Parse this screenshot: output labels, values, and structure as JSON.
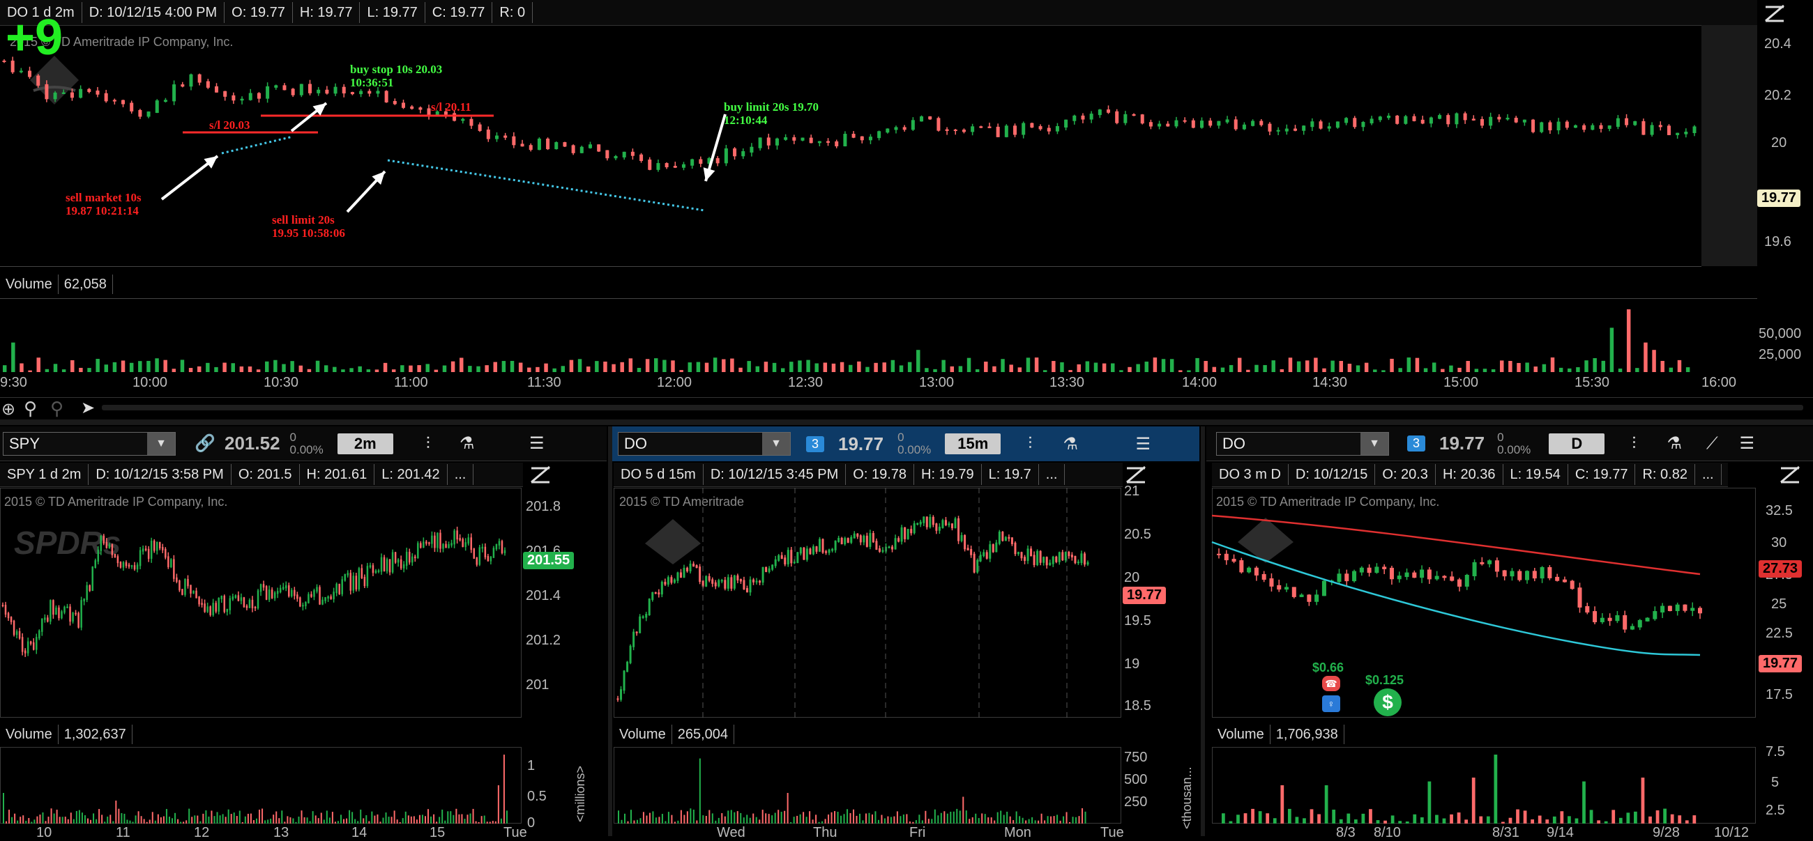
{
  "main": {
    "header": {
      "symbol_period": "DO 1 d 2m",
      "date": "D: 10/12/15 4:00 PM",
      "open": "O: 19.77",
      "high": "H: 19.77",
      "low": "L: 19.77",
      "close": "C: 19.77",
      "range": "R: 0"
    },
    "big_score": "+9",
    "copyright": "2015 © TD Ameritrade IP Company, Inc.",
    "logo_text": "DIAMOND",
    "price_axis": [
      "20.4",
      "20.2",
      "20",
      "19.6"
    ],
    "last_price_tag": "19.77",
    "annotations": {
      "sell_market": "sell market 10s",
      "sell_market_time": "19.87 10:21:14",
      "buy_stop": "buy stop 10s 20.03",
      "buy_stop_time": "10:36:51",
      "sl1": "s/l 20.03",
      "sl2": "s/l 20.11",
      "sell_limit": "sell limit 20s",
      "sell_limit_time": "19.95 10:58:06",
      "buy_limit": "buy limit 20s 19.70",
      "buy_limit_time": "12:10:44"
    },
    "volume_label": "Volume",
    "volume_value": "62,058",
    "volume_axis": [
      "50,000",
      "25,000"
    ],
    "time_axis": [
      "9:30",
      "10:00",
      "10:30",
      "11:00",
      "11:30",
      "12:00",
      "12:30",
      "13:00",
      "13:30",
      "14:00",
      "14:30",
      "15:00",
      "15:30",
      "16:00"
    ]
  },
  "spy": {
    "symbol": "SPY",
    "price": "201.52",
    "change": "0",
    "change_pct": "0.00%",
    "timeframe": "2m",
    "header": {
      "symbol_period": "SPY 1 d 2m",
      "date": "D: 10/12/15 3:58 PM",
      "open": "O: 201.5",
      "high": "H: 201.61",
      "low": "L: 201.42",
      "more": "..."
    },
    "copyright": "2015 © TD Ameritrade IP Company, Inc.",
    "logo_text": "SPDRs",
    "price_axis": [
      "201.8",
      "201.6",
      "201.4",
      "201.2",
      "201"
    ],
    "last_price_tag": "201.55",
    "volume_label": "Volume",
    "volume_value": "1,302,637",
    "volume_axis": [
      "1",
      "0.5",
      "0"
    ],
    "volume_unit": "<millions>",
    "time_axis": [
      "10",
      "11",
      "12",
      "13",
      "14",
      "15",
      "Tue"
    ]
  },
  "do5": {
    "symbol": "DO",
    "badge": "3",
    "price": "19.77",
    "change": "0",
    "change_pct": "0.00%",
    "timeframe": "15m",
    "header": {
      "symbol_period": "DO 5 d 15m",
      "date": "D: 10/12/15 3:45 PM",
      "open": "O: 19.78",
      "high": "H: 19.79",
      "low": "L: 19.7",
      "more": "..."
    },
    "copyright": "2015 © TD Ameritrade",
    "logo_text": "DIAMOND",
    "price_axis": [
      "21",
      "20.5",
      "20",
      "19.5",
      "19",
      "18.5"
    ],
    "last_price_tag": "19.77",
    "volume_label": "Volume",
    "volume_value": "265,004",
    "volume_axis": [
      "750",
      "500",
      "250"
    ],
    "volume_unit": "<thousan...",
    "time_axis": [
      "Wed",
      "Thu",
      "Fri",
      "Mon",
      "Tue"
    ]
  },
  "do3m": {
    "symbol": "DO",
    "badge": "3",
    "price": "19.77",
    "change": "0",
    "change_pct": "0.00%",
    "timeframe": "D",
    "header": {
      "symbol_period": "DO 3 m D",
      "date": "D: 10/12/15",
      "open": "O: 20.3",
      "high": "H: 20.36",
      "low": "L: 19.54",
      "close": "C: 19.77",
      "range": "R: 0.82",
      "more": "..."
    },
    "copyright": "2015 © TD Ameritrade IP Company, Inc.",
    "logo_text": "DIAMOND",
    "price_axis": [
      "32.5",
      "30",
      "27.5",
      "25",
      "22.5",
      "20",
      "17.5"
    ],
    "ma_tag": "27.73",
    "last_price_tag": "19.77",
    "dividend1": "$0.66",
    "dividend2": "$0.125",
    "volume_label": "Volume",
    "volume_value": "1,706,938",
    "volume_axis": [
      "7.5",
      "5",
      "2.5"
    ],
    "time_axis": [
      "8/3",
      "8/10",
      "8/31",
      "9/14",
      "9/28",
      "10/12"
    ]
  },
  "colors": {
    "up": "#22b14c",
    "down": "#ff6a6a",
    "annotation_green": "#44ff44",
    "annotation_red": "#ff2020",
    "stop_line": "#ff2a2a",
    "dotted_line": "#44c8e8",
    "ma_red": "#e03030",
    "ma_cyan": "#2ec8d8",
    "header_blue": "#0d3a66"
  }
}
